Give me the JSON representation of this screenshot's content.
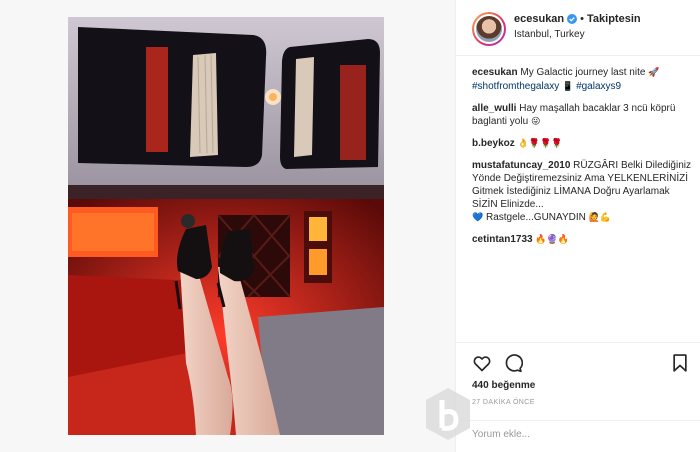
{
  "post": {
    "username": "ecesukan",
    "follow_status": "Takiptesin",
    "location": "Istanbul, Turkey",
    "likes": "440 beğenme",
    "timestamp": "27 DAKİKA ÖNCE",
    "comment_placeholder": "Yorum ekle..."
  },
  "caption": {
    "user": "ecesukan",
    "text": "My Galactic journey last nite",
    "emoji": "🚀",
    "hashtag1": "#shotfromthegalaxy",
    "emoji2": "📱",
    "hashtag2": "#galaxys9"
  },
  "comments": [
    {
      "user": "alle_wulli",
      "text": "Hay maşallah bacaklar 3 ncü köprü baglanti yolu",
      "emoji": "😜"
    },
    {
      "user": "b.beykoz",
      "text": "",
      "emoji": "👌🌹🌹🌹"
    },
    {
      "user": "mustafatuncay_2010",
      "text": "RÜZGÂRI Belki Dilediğiniz Yönde Değiştiremezsiniz Ama YELKENLERİNİZİ Gitmek İstediğiniz LİMANA Doğru Ayarlamak SİZİN Elinizde...",
      "emoji": "💙",
      "text2": "Rastgele...GUNAYDIN",
      "emoji2": "🙋💪"
    },
    {
      "user": "cetintan1733",
      "text": "",
      "emoji": "🔥🔮🔥"
    }
  ],
  "colors": {
    "link": "#003569",
    "verified": "#3897f0",
    "interior_red": "#d0231b"
  },
  "icons": {
    "like": "heart-icon",
    "comment": "comment-bubble-icon",
    "save": "bookmark-icon",
    "verified": "verified-badge-icon"
  }
}
